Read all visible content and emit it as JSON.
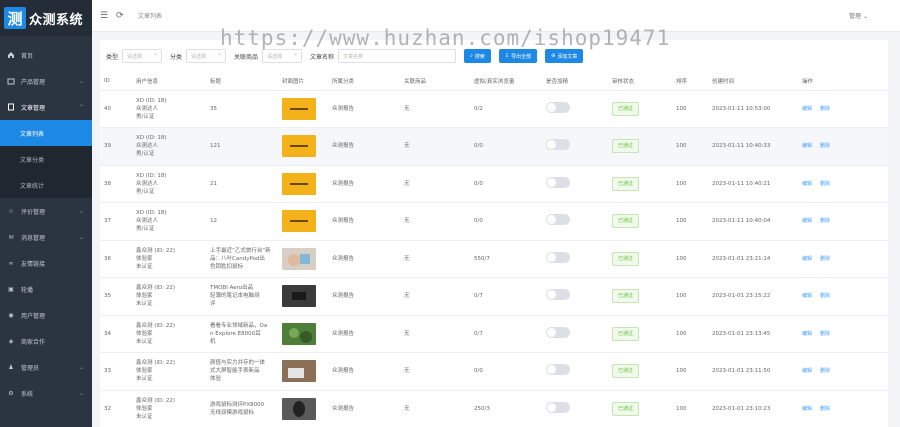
{
  "app": {
    "logo_char": "测",
    "logo_text": "众测系统"
  },
  "sidebar": {
    "items": [
      {
        "label": "首页",
        "icon": "home-icon"
      },
      {
        "label": "产品管理",
        "icon": "box-icon"
      },
      {
        "label": "文章管理",
        "icon": "document-icon"
      },
      {
        "label": "评价管理",
        "icon": "star-icon"
      },
      {
        "label": "消息管理",
        "icon": "message-icon"
      },
      {
        "label": "友情链接",
        "icon": "link-icon"
      },
      {
        "label": "轮播",
        "icon": "image-icon"
      },
      {
        "label": "用户管理",
        "icon": "user-icon"
      },
      {
        "label": "商家合作",
        "icon": "handshake-icon"
      },
      {
        "label": "管理员",
        "icon": "admin-icon"
      },
      {
        "label": "系统",
        "icon": "gear-icon"
      }
    ],
    "submenu": [
      "文章列表",
      "文章分类",
      "文章统计"
    ]
  },
  "topbar": {
    "breadcrumb": "文章列表",
    "user": "管理"
  },
  "watermark": "https://www.huzhan.com/ishop19471",
  "filters": {
    "type_label": "类型",
    "type_placeholder": "请选择",
    "category_label": "分类",
    "category_placeholder": "请选择",
    "product_label": "关联商品",
    "product_placeholder": "请选择",
    "title_label": "文章名称",
    "title_placeholder": "文章名称",
    "search_btn": "搜索",
    "export_btn": "导出全部",
    "add_btn": "添加文章"
  },
  "table": {
    "headers": [
      "ID",
      "用户信息",
      "标题",
      "封面图片",
      "所属分类",
      "关联商品",
      "虚拟/真实浏览量",
      "是否加精",
      "审核状态",
      "排序",
      "创建时间",
      "操作"
    ],
    "rows": [
      {
        "id": "40",
        "user": "XD (ID: 18)\n众测达人\n男/认证",
        "title": "35",
        "thumb": "yellow",
        "category": "众测报告",
        "product": "无",
        "views": "0/2",
        "status": "已通过",
        "sort": "100",
        "time": "2023-01-11 10:53:00"
      },
      {
        "id": "39",
        "user": "XD (ID: 18)\n众测达人\n男/认证",
        "title": "121",
        "thumb": "yellow",
        "category": "众测报告",
        "product": "无",
        "views": "0/0",
        "status": "已通过",
        "sort": "100",
        "time": "2023-01-11 10:40:33"
      },
      {
        "id": "38",
        "user": "XD (ID: 18)\n众测达人\n男/认证",
        "title": "21",
        "thumb": "yellow",
        "category": "众测报告",
        "product": "无",
        "views": "0/0",
        "status": "已通过",
        "sort": "100",
        "time": "2023-01-11 10:40:21"
      },
      {
        "id": "37",
        "user": "XD (ID: 18)\n众测达人\n男/认证",
        "title": "12",
        "thumb": "yellow",
        "category": "众测报告",
        "product": "无",
        "views": "0/0",
        "status": "已通过",
        "sort": "100",
        "time": "2023-01-11 10:40:04"
      },
      {
        "id": "36",
        "user": "鑫众测 (ID: 22)\n体验家\n未认证",
        "title": "上手最近“乙式旅行台”新\n品：八叶CandyPod出\n色钥匙扣鼠标",
        "thumb": "hands",
        "category": "众测报告",
        "product": "无",
        "views": "550/7",
        "status": "已通过",
        "sort": "100",
        "time": "2023-01-01 23:21:14"
      },
      {
        "id": "35",
        "user": "鑫众测 (ID: 22)\n体验家\n未认证",
        "title": "TMOBI Aero出品\n轻薄的笔记本电脑测\n评",
        "thumb": "dark",
        "category": "众测报告",
        "product": "无",
        "views": "0/7",
        "status": "已通过",
        "sort": "100",
        "time": "2023-01-01 23:15:22"
      },
      {
        "id": "34",
        "user": "鑫众测 (ID: 22)\n体验家\n未认证",
        "title": "看看专业领域新品，Oa\nn Explore E8000耳\n机",
        "thumb": "green",
        "category": "众测报告",
        "product": "无",
        "views": "0/7",
        "status": "已通过",
        "sort": "100",
        "time": "2023-01-01 23:13:45"
      },
      {
        "id": "33",
        "user": "鑫众测 (ID: 22)\n体验家\n未认证",
        "title": "颜值与实力并存的一体\n式大屏智能手表新品\n体验",
        "thumb": "desk",
        "category": "众测报告",
        "product": "无",
        "views": "0/0",
        "status": "已通过",
        "sort": "100",
        "time": "2023-01-01 23:11:50"
      },
      {
        "id": "32",
        "user": "鑫众测 (ID: 22)\n体验家\n未认证",
        "title": "游戏鼠标测评PX8000\n无线双模游戏鼠标",
        "thumb": "mouse",
        "category": "众测报告",
        "product": "无",
        "views": "250/3",
        "status": "已通过",
        "sort": "100",
        "time": "2023-01-01 23:10:23"
      }
    ],
    "edit_label": "编辑",
    "delete_label": "删除"
  },
  "colors": {
    "accent": "#1e88e5",
    "sidebar_bg": "#2b3441",
    "success": "#67c23a"
  }
}
